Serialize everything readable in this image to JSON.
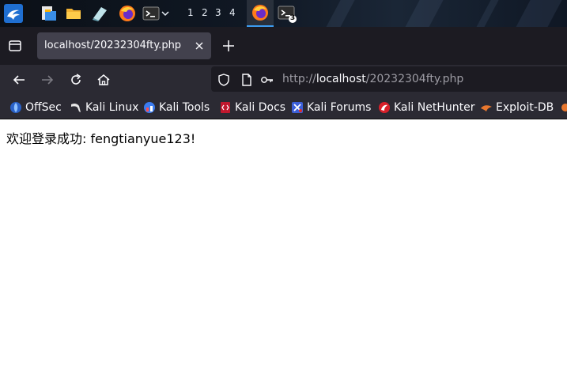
{
  "taskbar": {
    "workspaces": [
      "1",
      "2",
      "3",
      "4"
    ],
    "terminal_badge": "3"
  },
  "tab": {
    "title": "localhost/20232304fty.php"
  },
  "urlbar": {
    "scheme": "http://",
    "host": "localhost",
    "path": "/20232304fty.php"
  },
  "bookmarks": [
    {
      "label": "OffSec",
      "icon": "offsec-icon",
      "color": "#3a7bd5"
    },
    {
      "label": "Kali Linux",
      "icon": "kali-dragon-icon",
      "color": "#e6e6e6"
    },
    {
      "label": "Kali Tools",
      "icon": "kali-tools-icon",
      "color": "#3c7cf0"
    },
    {
      "label": "Kali Docs",
      "icon": "kali-docs-icon",
      "color": "#c0182e"
    },
    {
      "label": "Kali Forums",
      "icon": "kali-forums-icon",
      "color": "#3c5fd8"
    },
    {
      "label": "Kali NetHunter",
      "icon": "nethunter-icon",
      "color": "#d8202a"
    },
    {
      "label": "Exploit-DB",
      "icon": "exploit-db-icon",
      "color": "#e8772e"
    }
  ],
  "page": {
    "message": "欢迎登录成功: fengtianyue123!"
  }
}
